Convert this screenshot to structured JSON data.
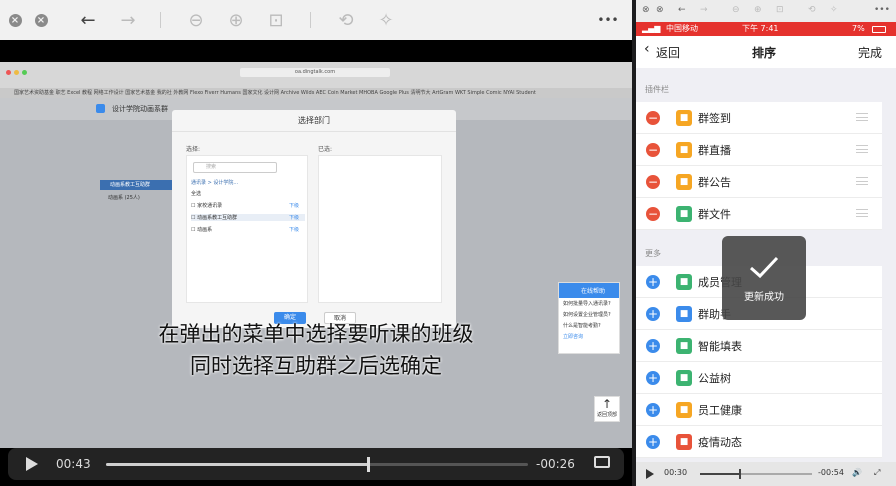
{
  "left_player": {
    "toolbar_icons": [
      "close-icon",
      "close-icon",
      "back-arrow-icon",
      "forward-arrow-icon",
      "zoom-out-icon",
      "zoom-in-icon",
      "fit-window-icon",
      "rotate-icon",
      "magic-wand-icon",
      "more-icon"
    ],
    "more_glyph": "•••",
    "browser": {
      "url": "oa.dingtalk.com",
      "bookmarks": "国家艺术资助基金  职艺  Excel 教程  网络工作设计  国家艺术基金  我的社  外教网  Flexo  Fiverr  Humans  国家文化  设计网  Archive  Wilds  AEC  Coin Market  MHOBA  Google Plus  清明节大  ArtGram  WKT  Simple Comic  NYAI Student",
      "app_title": "设计学院动画系群",
      "dept_dropdown": "动画系教工互助群",
      "dept_list_item": "动画系 (25人)"
    },
    "modal": {
      "title": "选择部门",
      "select_label": "选择:",
      "selected_label": "已选:",
      "search_placeholder": "搜索",
      "breadcrumb": "通讯录 > 设计学院...",
      "select_all": "全选",
      "items": [
        {
          "label": "家校通讯录",
          "action": "下级"
        },
        {
          "label": "动画系教工互助群",
          "action": "下级"
        },
        {
          "label": "动画系",
          "action": "下级"
        }
      ],
      "confirm": "确定",
      "cancel": "取消"
    },
    "help_widget": {
      "title": "在线帮助",
      "lines": [
        "如何批量导入通讯录?",
        "如何设置企业管理员?",
        "什么是智能考勤?"
      ],
      "link": "立即咨询"
    },
    "back_top_label": "返回顶部",
    "subtitle_line1": "在弹出的菜单中选择要听课的班级",
    "subtitle_line2": "同时选择互助群之后选确定",
    "elapsed": "00:43",
    "remaining": "-00:26",
    "progress": 0.62
  },
  "right_player": {
    "status": {
      "carrier": "中国移动",
      "time": "下午 7:41",
      "battery": "7%"
    },
    "nav": {
      "back": "返回",
      "title": "排序",
      "done": "完成"
    },
    "plugin_section": "插件栏",
    "plugins": [
      {
        "name": "群签到",
        "color": "#f6a623"
      },
      {
        "name": "群直播",
        "color": "#f6a623"
      },
      {
        "name": "群公告",
        "color": "#f6a623"
      },
      {
        "name": "群文件",
        "color": "#3cb371"
      }
    ],
    "more_section": "更多",
    "more": [
      {
        "name": "成员管理",
        "color": "#3cb371"
      },
      {
        "name": "群助手",
        "color": "#3b8beb"
      },
      {
        "name": "智能填表",
        "color": "#3cb371"
      },
      {
        "name": "公益树",
        "color": "#3cb371"
      },
      {
        "name": "员工健康",
        "color": "#f6a623"
      },
      {
        "name": "疫情动态",
        "color": "#e8533a"
      }
    ],
    "toast": "更新成功",
    "elapsed": "00:30",
    "remaining": "-00:54",
    "progress": 0.36
  }
}
